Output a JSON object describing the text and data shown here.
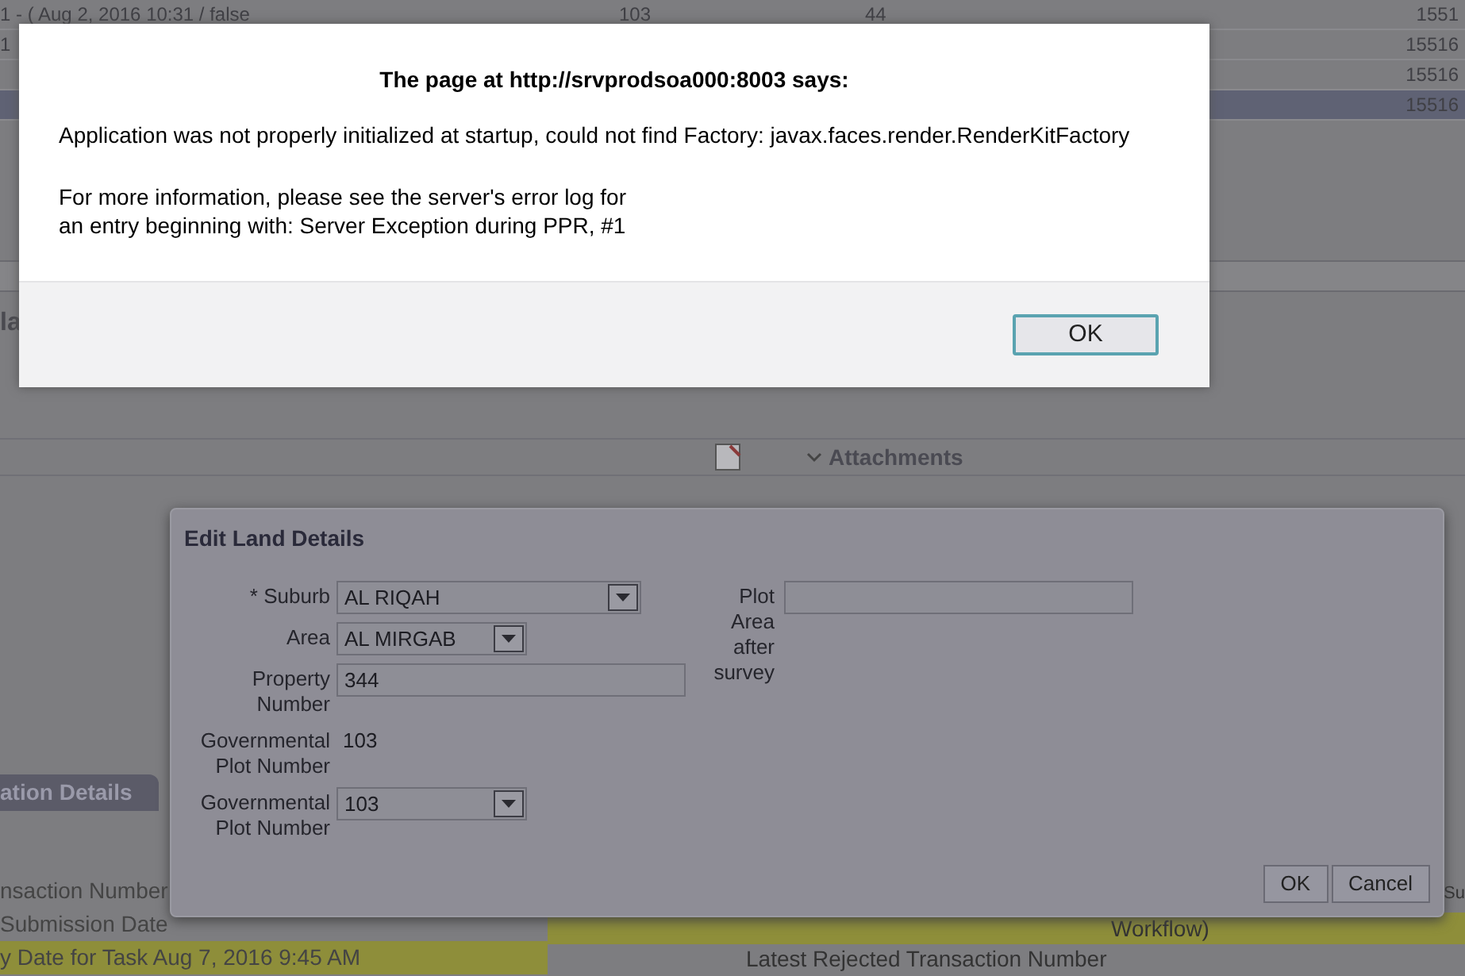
{
  "background_page": {
    "table_rows": [
      {
        "cells": [
          "1 - ( Aug 2, 2016 10:31 / false",
          "103",
          "44"
        ],
        "id": "1551",
        "selected": false
      },
      {
        "cells": [
          "1"
        ],
        "id": "15516",
        "selected": false
      },
      {
        "cells": [],
        "id": "15516",
        "selected": false
      },
      {
        "cells": [],
        "id": "15516",
        "selected": true
      }
    ],
    "section_title": "la",
    "attachments": {
      "label": "Attachments"
    },
    "tab": "ation Details",
    "rows": [
      {
        "label": "nsaction Number",
        "highlighted": false
      },
      {
        "label": "Submission Date",
        "highlighted": false
      },
      {
        "label": "y Date for Task  Aug 7, 2016 9:45 AM",
        "highlighted": true
      }
    ],
    "right_texts": [
      "Su",
      "Workflow)",
      "Latest Rejected Transaction Number"
    ]
  },
  "edit_land_details": {
    "title": "Edit Land Details",
    "fields": [
      {
        "label": "Suburb",
        "required_marker": "*",
        "kind": "select",
        "value": "AL RIQAH"
      },
      {
        "label": "Area",
        "kind": "select",
        "value": "AL MIRGAB"
      },
      {
        "label": "Property Number",
        "kind": "text",
        "value": "344"
      },
      {
        "label": "Governmental Plot Number",
        "kind": "readonly",
        "value": "103"
      },
      {
        "label": "Governmental Plot Number",
        "kind": "select",
        "value": "103"
      }
    ],
    "side_field": {
      "label": "Plot Area after survey",
      "kind": "text"
    },
    "buttons": [
      "OK",
      "Cancel"
    ]
  },
  "alert": {
    "title": "The page at http://srvprodsoa000:8003 says:",
    "message": "Application was not properly initialized at startup, could not find Factory: javax.faces.render.RenderKitFactory",
    "details": [
      "For more information, please see the server's error log for",
      "an entry beginning with: Server Exception during PPR, #1"
    ],
    "button": "OK"
  }
}
